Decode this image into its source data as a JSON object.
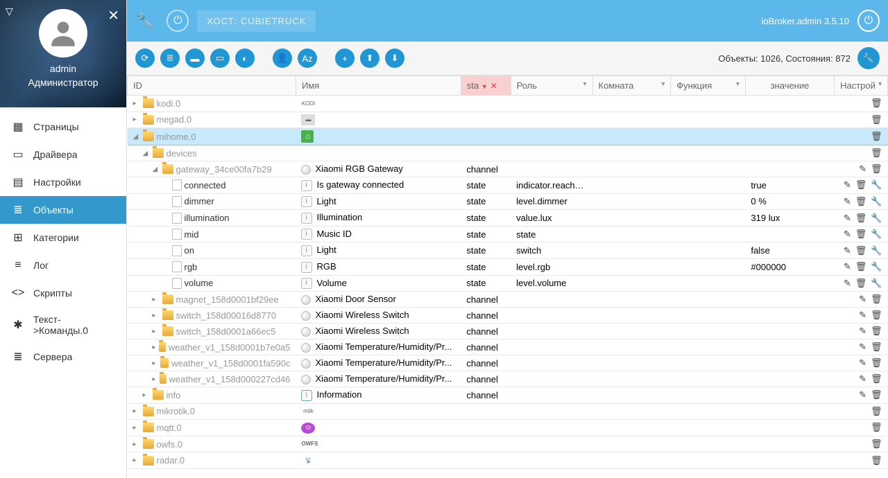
{
  "user": {
    "name": "admin",
    "role": "Администратор"
  },
  "nav": [
    {
      "label": "Страницы",
      "icon": "▦"
    },
    {
      "label": "Драйвера",
      "icon": "▭"
    },
    {
      "label": "Настройки",
      "icon": "▤"
    },
    {
      "label": "Объекты",
      "icon": "≣",
      "active": true
    },
    {
      "label": "Категории",
      "icon": "⊞"
    },
    {
      "label": "Лог",
      "icon": "≡"
    },
    {
      "label": "Скрипты",
      "icon": "<>"
    },
    {
      "label": "Текст->Команды.0",
      "icon": "✱"
    },
    {
      "label": "Сервера",
      "icon": "≣"
    }
  ],
  "topbar": {
    "host": "ХОСТ: CUBIETRUCK",
    "version": "ioBroker.admin 3.5.10"
  },
  "stats": "Объекты: 1026, Состояния: 872",
  "columns": {
    "id": "ID",
    "name": "Имя",
    "sta": "sta",
    "role": "Роль",
    "room": "Комната",
    "func": "Функция",
    "value": "значение",
    "actions": "Настрой"
  },
  "rows": [
    {
      "indent": 0,
      "exp": "▸",
      "ic": "f",
      "id": "kodi.0",
      "nameIcon": "kodi",
      "act": "d"
    },
    {
      "indent": 0,
      "exp": "▸",
      "ic": "f",
      "id": "megad.0",
      "nameIcon": "mega",
      "act": "d"
    },
    {
      "indent": 0,
      "exp": "◢",
      "ic": "f",
      "id": "mihome.0",
      "nameIcon": "mi",
      "act": "d",
      "hl": true
    },
    {
      "indent": 1,
      "exp": "◢",
      "ic": "f",
      "id": "devices",
      "act": "d"
    },
    {
      "indent": 2,
      "exp": "◢",
      "ic": "f",
      "id": "gateway_34ce00fa7b29",
      "chan": true,
      "name": "Xiaomi RGB Gateway",
      "sta": "channel",
      "act": "ed"
    },
    {
      "indent": 3,
      "ic": "d",
      "id": "connected",
      "leaf": true,
      "state": true,
      "name": "Is gateway connected",
      "sta": "state",
      "role": "indicator.reachable",
      "value": "true",
      "act": "edw"
    },
    {
      "indent": 3,
      "ic": "d",
      "id": "dimmer",
      "leaf": true,
      "state": true,
      "name": "Light",
      "sta": "state",
      "role": "level.dimmer",
      "value": "0 %",
      "act": "edw"
    },
    {
      "indent": 3,
      "ic": "d",
      "id": "illumination",
      "leaf": true,
      "state": true,
      "name": "Illumination",
      "sta": "state",
      "role": "value.lux",
      "value": "319 lux",
      "act": "edw"
    },
    {
      "indent": 3,
      "ic": "d",
      "id": "mid",
      "leaf": true,
      "state": true,
      "name": "Music ID",
      "sta": "state",
      "role": "state",
      "act": "edw"
    },
    {
      "indent": 3,
      "ic": "d",
      "id": "on",
      "leaf": true,
      "state": true,
      "name": "Light",
      "sta": "state",
      "role": "switch",
      "value": "false",
      "act": "edw"
    },
    {
      "indent": 3,
      "ic": "d",
      "id": "rgb",
      "leaf": true,
      "state": true,
      "name": "RGB",
      "sta": "state",
      "role": "level.rgb",
      "value": "#000000",
      "act": "edw"
    },
    {
      "indent": 3,
      "ic": "d",
      "id": "volume",
      "leaf": true,
      "state": true,
      "name": "Volume",
      "sta": "state",
      "role": "level.volume",
      "act": "edw"
    },
    {
      "indent": 2,
      "exp": "▸",
      "ic": "f",
      "id": "magnet_158d0001bf29ee",
      "chan": true,
      "name": "Xiaomi Door Sensor",
      "sta": "channel",
      "act": "ed"
    },
    {
      "indent": 2,
      "exp": "▸",
      "ic": "f",
      "id": "switch_158d00016d8770",
      "chan": true,
      "name": "Xiaomi Wireless Switch",
      "sta": "channel",
      "act": "ed"
    },
    {
      "indent": 2,
      "exp": "▸",
      "ic": "f",
      "id": "switch_158d0001a66ec5",
      "chan": true,
      "name": "Xiaomi Wireless Switch",
      "sta": "channel",
      "act": "ed"
    },
    {
      "indent": 2,
      "exp": "▸",
      "ic": "f",
      "id": "weather_v1_158d0001b7e0a5",
      "chan": true,
      "name": "Xiaomi Temperature/Humidity/Pr...",
      "sta": "channel",
      "act": "ed"
    },
    {
      "indent": 2,
      "exp": "▸",
      "ic": "f",
      "id": "weather_v1_158d0001fa590c",
      "chan": true,
      "name": "Xiaomi Temperature/Humidity/Pr...",
      "sta": "channel",
      "act": "ed"
    },
    {
      "indent": 2,
      "exp": "▸",
      "ic": "f",
      "id": "weather_v1_158d000227cd46",
      "chan": true,
      "name": "Xiaomi Temperature/Humidity/Pr...",
      "sta": "channel",
      "act": "ed"
    },
    {
      "indent": 1,
      "exp": "▸",
      "ic": "f",
      "id": "info",
      "state2": true,
      "name": "Information",
      "sta": "channel",
      "act": "ed"
    },
    {
      "indent": 0,
      "exp": "▸",
      "ic": "f",
      "id": "mikrotik.0",
      "nameIcon": "mtik",
      "act": "d"
    },
    {
      "indent": 0,
      "exp": "▸",
      "ic": "f",
      "id": "mqtt.0",
      "nameIcon": "mqtt",
      "act": "d"
    },
    {
      "indent": 0,
      "exp": "▸",
      "ic": "f",
      "id": "owfs.0",
      "nameIcon": "owfs",
      "act": "d"
    },
    {
      "indent": 0,
      "exp": "▸",
      "ic": "f",
      "id": "radar.0",
      "nameIcon": "radar",
      "act": "d"
    }
  ]
}
